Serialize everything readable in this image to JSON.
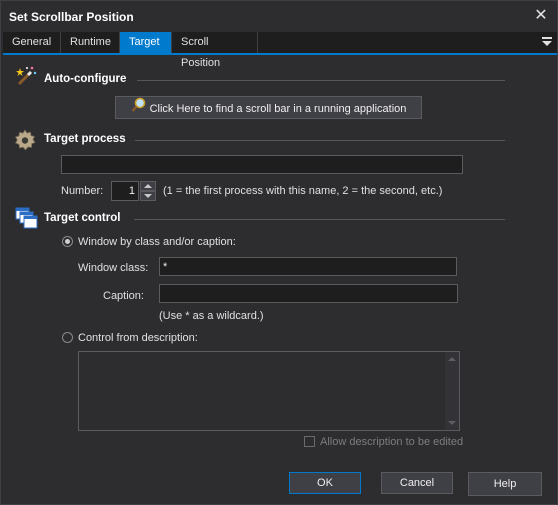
{
  "window": {
    "title": "Set Scrollbar Position",
    "close_glyph": "✕"
  },
  "tabs": [
    {
      "label": "General",
      "active": false
    },
    {
      "label": "Runtime",
      "active": false
    },
    {
      "label": "Target",
      "active": true
    },
    {
      "label": "Scroll Position",
      "active": false
    }
  ],
  "auto_configure": {
    "title": "Auto-configure",
    "icon": "magic-wand-icon",
    "button_label": "Click Here to find a scroll bar in a running application",
    "button_icon": "search-icon"
  },
  "target_process": {
    "title": "Target process",
    "icon": "gear-icon",
    "process_value": "",
    "number_label": "Number:",
    "number_value": "1",
    "number_hint": "(1 = the first process with this name, 2 = the second, etc.)"
  },
  "target_control": {
    "title": "Target control",
    "icon": "windows-icon",
    "option_class_caption": "Window by class and/or caption:",
    "option_class_caption_selected": true,
    "window_class_label": "Window class:",
    "window_class_value": "*",
    "caption_label": "Caption:",
    "caption_value": "",
    "wildcard_hint": "(Use * as a wildcard.)",
    "option_description": "Control from description:",
    "option_description_selected": false,
    "description_value": "",
    "allow_edit_label": "Allow description to be edited",
    "allow_edit_checked": false
  },
  "buttons": {
    "ok": "OK",
    "cancel": "Cancel",
    "help": "Help"
  },
  "colors": {
    "accent": "#007acc",
    "background": "#2d2d30",
    "field": "#1e1e1e"
  }
}
